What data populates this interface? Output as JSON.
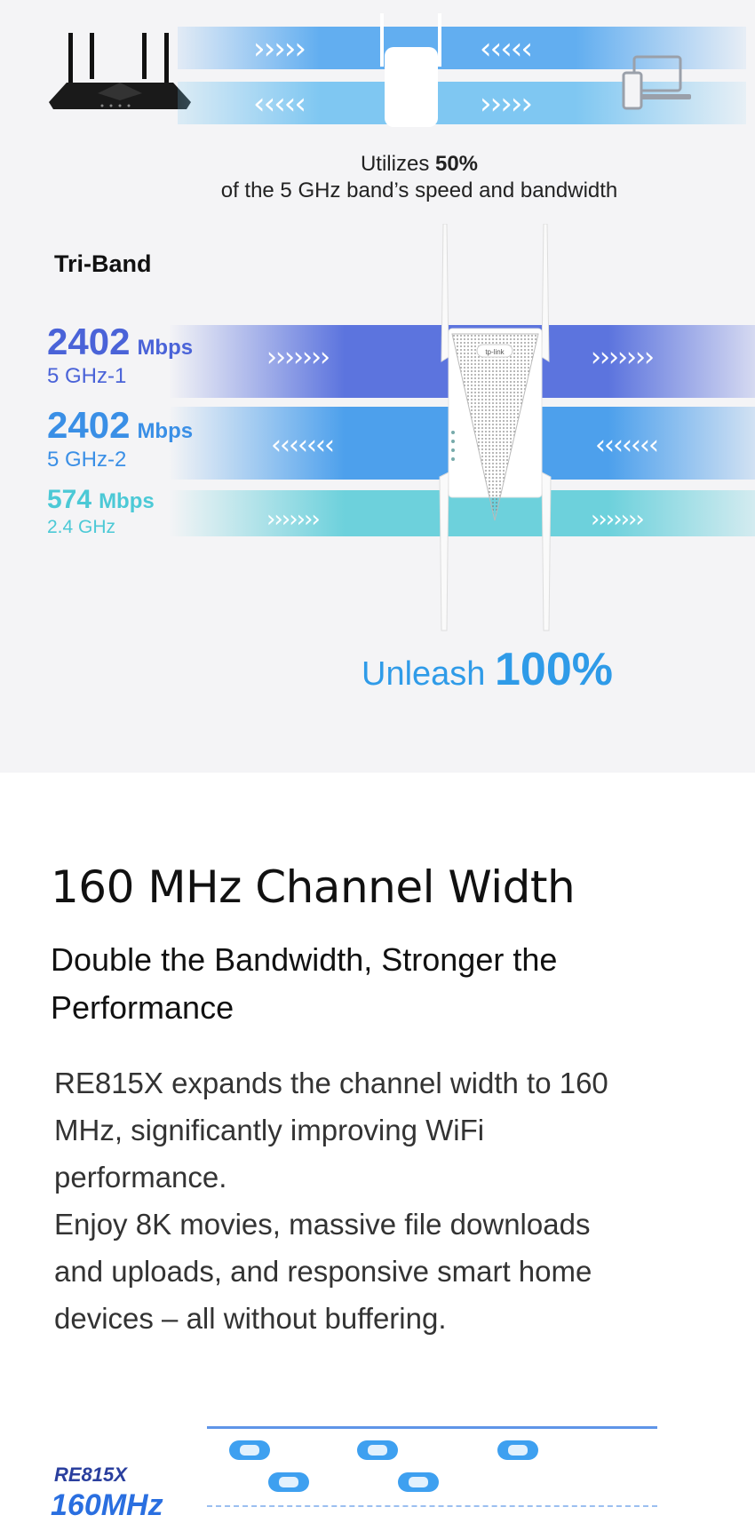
{
  "top_diagram": {
    "arrows_right": "›››››",
    "arrows_left": "‹‹‹‹‹",
    "caption_prefix": "Utilizes ",
    "caption_value": "50%",
    "caption_line2": "of the 5 GHz band’s speed and bandwidth"
  },
  "triband": {
    "heading": "Tri-Band",
    "extender_logo": "tp-link",
    "bands": [
      {
        "speed": "2402",
        "unit": "Mbps",
        "label": "5 GHz-1",
        "arrows": "›››››››",
        "color": "#4a63d8"
      },
      {
        "speed": "2402",
        "unit": "Mbps",
        "label": "5 GHz-2",
        "arrows": "‹‹‹‹‹‹‹",
        "color": "#3a8fe6"
      },
      {
        "speed": "574",
        "unit": "Mbps",
        "label": "2.4 GHz",
        "arrows": "›››››››",
        "color": "#4cc9d6"
      }
    ],
    "unleash_prefix": "Unleash ",
    "unleash_value": "100%"
  },
  "feature": {
    "title": "160 MHz Channel Width",
    "subtitle_line1": "Double the Bandwidth, Stronger the",
    "subtitle_line2": "Performance",
    "para1_line1": "RE815X expands the channel width to 160",
    "para1_line2": "MHz, significantly improving WiFi",
    "para1_line3": "performance.",
    "para2_line1": "Enjoy 8K movies, massive file downloads",
    "para2_line2": "and uploads, and responsive smart home",
    "para2_line3": "devices – all without buffering."
  },
  "lanes": {
    "model": "RE815X",
    "width": "160MHz"
  },
  "colors": {
    "band1": "#4a63d8",
    "band2": "#3a8fe6",
    "band3": "#4cc9d6",
    "unleash": "#2f9be8",
    "background_top": "#f4f4f6"
  }
}
